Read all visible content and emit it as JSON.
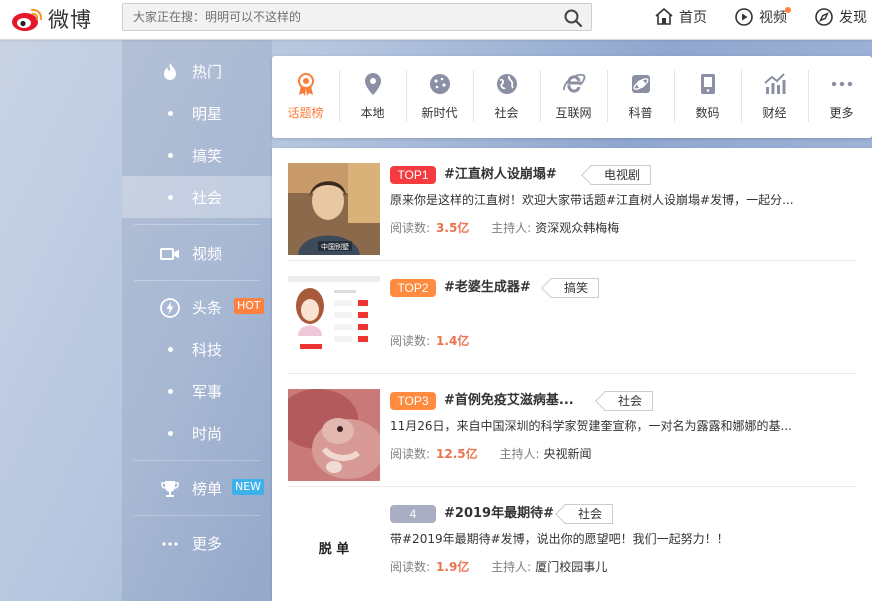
{
  "header": {
    "logo_text": "微博",
    "search_placeholder": "大家正在搜：明明可以不这样的",
    "nav": [
      {
        "label": "首页",
        "icon": "home-icon"
      },
      {
        "label": "视频",
        "icon": "video-icon"
      },
      {
        "label": "发现",
        "icon": "compass-icon"
      }
    ]
  },
  "sidebar": {
    "items": [
      {
        "label": "热门",
        "icon": "flame-icon"
      },
      {
        "label": "明星"
      },
      {
        "label": "搞笑"
      },
      {
        "label": "社会",
        "active": true
      },
      {
        "label": "视频",
        "icon": "camera-icon"
      },
      {
        "label": "头条",
        "icon": "bolt-icon",
        "tag": "HOT"
      },
      {
        "label": "科技"
      },
      {
        "label": "军事"
      },
      {
        "label": "时尚"
      },
      {
        "label": "榜单",
        "icon": "trophy-icon",
        "tag": "NEW"
      },
      {
        "label": "更多",
        "icon": "more-icon"
      }
    ]
  },
  "categories": [
    {
      "label": "话题榜",
      "icon": "medal-icon",
      "active": true
    },
    {
      "label": "本地",
      "icon": "location-icon"
    },
    {
      "label": "新时代",
      "icon": "cookie-icon"
    },
    {
      "label": "社会",
      "icon": "globe-icon"
    },
    {
      "label": "互联网",
      "icon": "ie-icon"
    },
    {
      "label": "科普",
      "icon": "planet-icon"
    },
    {
      "label": "数码",
      "icon": "phone-icon"
    },
    {
      "label": "财经",
      "icon": "chart-icon"
    },
    {
      "label": "更多",
      "icon": "dots-icon"
    }
  ],
  "topics": [
    {
      "rank": "TOP1",
      "title": "#江直树人设崩塌#",
      "tag": "电视剧",
      "desc": "原来你是这样的江直树！欢迎大家带话题#江直树人设崩塌#发博，一起分...",
      "read_label": "阅读数:",
      "reads": "3.5亿",
      "host_label": "主持人:",
      "host": "资深观众韩梅梅",
      "thumb_caption": "中国别墅"
    },
    {
      "rank": "TOP2",
      "title": "#老婆生成器#",
      "tag": "搞笑",
      "desc": "",
      "read_label": "阅读数:",
      "reads": "1.4亿",
      "host_label": "",
      "host": ""
    },
    {
      "rank": "TOP3",
      "title": "#首例免疫艾滋病基...",
      "tag": "社会",
      "desc": "11月26日，来自中国深圳的科学家贺建奎宣称，一对名为露露和娜娜的基...",
      "read_label": "阅读数:",
      "reads": "12.5亿",
      "host_label": "主持人:",
      "host": "央视新闻"
    },
    {
      "rank": "4",
      "title": "#2019年最期待#",
      "tag": "社会",
      "desc": "带#2019年最期待#发博，说出你的愿望吧！我们一起努力！！",
      "read_label": "阅读数:",
      "reads": "1.9亿",
      "host_label": "主持人:",
      "host": "厦门校园事儿",
      "thumb_text": "脱 单"
    }
  ],
  "colors": {
    "accent": "#fa7d3c",
    "rank1": "#f63b40",
    "rank23": "#fe8b3f",
    "rank_other": "#aaaec4",
    "read_num": "#eb7350"
  }
}
